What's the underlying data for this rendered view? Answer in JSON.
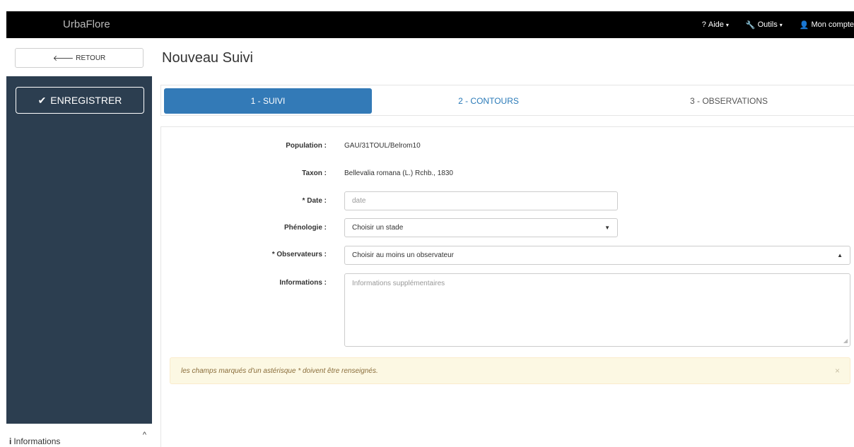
{
  "navbar": {
    "brand": "UrbaFlore",
    "menu": [
      {
        "icon": "question-icon",
        "glyph": "?",
        "label": "Aide"
      },
      {
        "icon": "wrench-icon",
        "glyph": "🔧",
        "label": "Outils"
      },
      {
        "icon": "user-icon",
        "glyph": "👤",
        "label": "Mon compte"
      }
    ]
  },
  "sidebar": {
    "back_label": "RETOUR",
    "save_label": "ENREGISTRER",
    "info_label": "Informations"
  },
  "main": {
    "title": "Nouveau Suivi",
    "tabs": [
      {
        "label": "1 - SUIVI",
        "active": true
      },
      {
        "label": "2 - CONTOURS",
        "active": false
      },
      {
        "label": "3 - OBSERVATIONS",
        "active": false
      }
    ],
    "form": {
      "population_label": "Population :",
      "population_value": "GAU/31TOUL/Belrom10",
      "taxon_label": "Taxon :",
      "taxon_value": "Bellevalia romana (L.) Rchb., 1830",
      "date_label": "* Date :",
      "date_placeholder": "date",
      "phenologie_label": "Phénologie :",
      "phenologie_value": "Choisir un stade",
      "observateurs_label": "* Observateurs :",
      "observateurs_value": "Choisir au moins un observateur",
      "informations_label": "Informations :",
      "informations_placeholder": "Informations supplémentaires"
    },
    "alert": {
      "text": "les champs marqués d'un astérisque * doivent être renseignés.",
      "close": "×"
    }
  },
  "colors": {
    "navbar": "#000000",
    "sidebar": "#2c3e50",
    "tab_active": "#337ab7",
    "alert_bg": "#fcf8e3"
  }
}
